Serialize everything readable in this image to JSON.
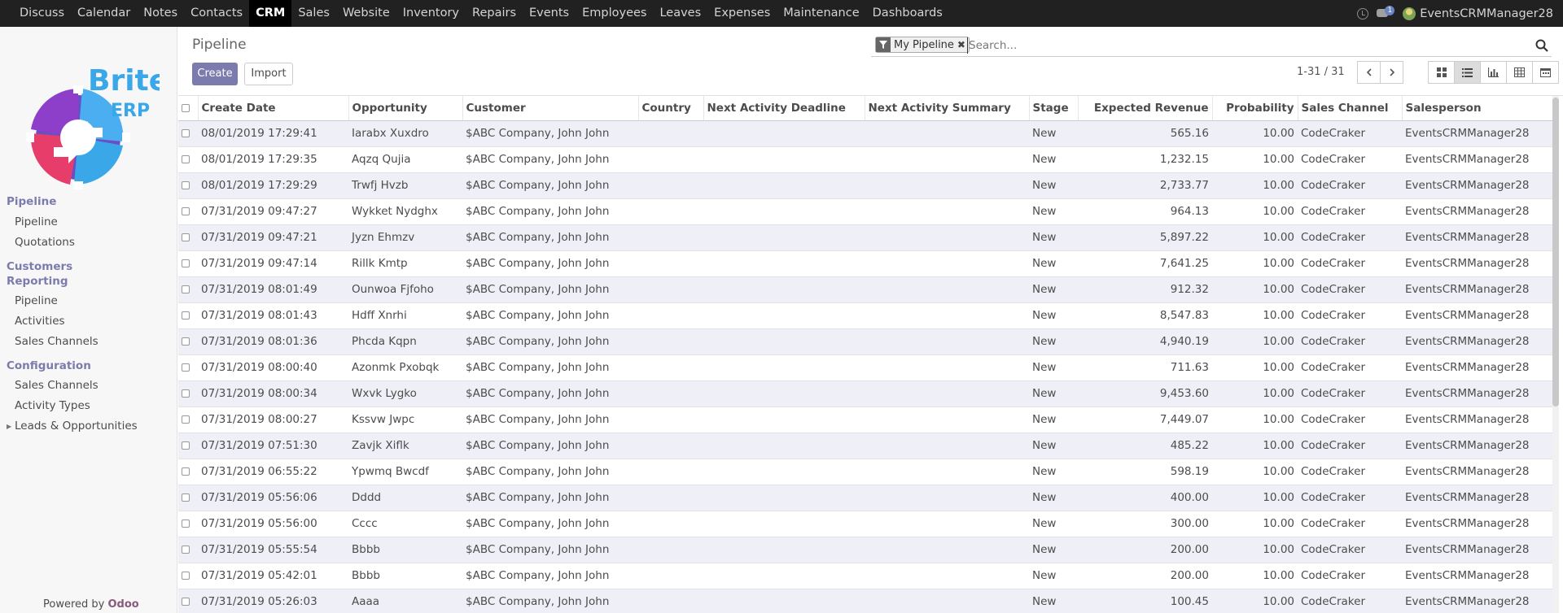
{
  "topbar": {
    "menu": [
      "Discuss",
      "Calendar",
      "Notes",
      "Contacts",
      "CRM",
      "Sales",
      "Website",
      "Inventory",
      "Repairs",
      "Events",
      "Employees",
      "Leaves",
      "Expenses",
      "Maintenance",
      "Dashboards"
    ],
    "active": "CRM",
    "chat_count": "1",
    "user": "EventsCRMManager28"
  },
  "logo": {
    "line1": "Brite",
    "line2": "ERP"
  },
  "sidebar": {
    "section_pipeline": "Pipeline",
    "item_pipeline": "Pipeline",
    "item_quotations": "Quotations",
    "section_customers": "Customers",
    "section_reporting": "Reporting",
    "rep_pipeline": "Pipeline",
    "rep_activities": "Activities",
    "rep_sales_channels": "Sales Channels",
    "section_configuration": "Configuration",
    "conf_sales_channels": "Sales Channels",
    "conf_activity_types": "Activity Types",
    "conf_leads": "Leads & Opportunities",
    "powered_prefix": "Powered by",
    "powered_brand": "Odoo"
  },
  "control": {
    "breadcrumb": "Pipeline",
    "create_label": "Create",
    "import_label": "Import",
    "facet_label": "My Pipeline",
    "search_placeholder": "Search...",
    "pager": "1-31 / 31"
  },
  "table": {
    "headers": [
      "Create Date",
      "Opportunity",
      "Customer",
      "Country",
      "Next Activity Deadline",
      "Next Activity Summary",
      "Stage",
      "Expected Revenue",
      "Probability",
      "Sales Channel",
      "Salesperson"
    ],
    "rows": [
      [
        "08/01/2019 17:29:41",
        "Iarabx Xuxdro",
        "$ABC Company, John John",
        "",
        "",
        "",
        "New",
        "565.16",
        "10.00",
        "CodeCraker",
        "EventsCRMManager28"
      ],
      [
        "08/01/2019 17:29:35",
        "Aqzq Qujia",
        "$ABC Company, John John",
        "",
        "",
        "",
        "New",
        "1,232.15",
        "10.00",
        "CodeCraker",
        "EventsCRMManager28"
      ],
      [
        "08/01/2019 17:29:29",
        "Trwfj Hvzb",
        "$ABC Company, John John",
        "",
        "",
        "",
        "New",
        "2,733.77",
        "10.00",
        "CodeCraker",
        "EventsCRMManager28"
      ],
      [
        "07/31/2019 09:47:27",
        "Wykket Nydghx",
        "$ABC Company, John John",
        "",
        "",
        "",
        "New",
        "964.13",
        "10.00",
        "CodeCraker",
        "EventsCRMManager28"
      ],
      [
        "07/31/2019 09:47:21",
        "Jyzn Ehmzv",
        "$ABC Company, John John",
        "",
        "",
        "",
        "New",
        "5,897.22",
        "10.00",
        "CodeCraker",
        "EventsCRMManager28"
      ],
      [
        "07/31/2019 09:47:14",
        "Rillk Kmtp",
        "$ABC Company, John John",
        "",
        "",
        "",
        "New",
        "7,641.25",
        "10.00",
        "CodeCraker",
        "EventsCRMManager28"
      ],
      [
        "07/31/2019 08:01:49",
        "Ounwoa Fjfoho",
        "$ABC Company, John John",
        "",
        "",
        "",
        "New",
        "912.32",
        "10.00",
        "CodeCraker",
        "EventsCRMManager28"
      ],
      [
        "07/31/2019 08:01:43",
        "Hdff Xnrhi",
        "$ABC Company, John John",
        "",
        "",
        "",
        "New",
        "8,547.83",
        "10.00",
        "CodeCraker",
        "EventsCRMManager28"
      ],
      [
        "07/31/2019 08:01:36",
        "Phcda Kqpn",
        "$ABC Company, John John",
        "",
        "",
        "",
        "New",
        "4,940.19",
        "10.00",
        "CodeCraker",
        "EventsCRMManager28"
      ],
      [
        "07/31/2019 08:00:40",
        "Azonmk Pxobqk",
        "$ABC Company, John John",
        "",
        "",
        "",
        "New",
        "711.63",
        "10.00",
        "CodeCraker",
        "EventsCRMManager28"
      ],
      [
        "07/31/2019 08:00:34",
        "Wxvk Lygko",
        "$ABC Company, John John",
        "",
        "",
        "",
        "New",
        "9,453.60",
        "10.00",
        "CodeCraker",
        "EventsCRMManager28"
      ],
      [
        "07/31/2019 08:00:27",
        "Kssvw Jwpc",
        "$ABC Company, John John",
        "",
        "",
        "",
        "New",
        "7,449.07",
        "10.00",
        "CodeCraker",
        "EventsCRMManager28"
      ],
      [
        "07/31/2019 07:51:30",
        "Zavjk Xiflk",
        "$ABC Company, John John",
        "",
        "",
        "",
        "New",
        "485.22",
        "10.00",
        "CodeCraker",
        "EventsCRMManager28"
      ],
      [
        "07/31/2019 06:55:22",
        "Ypwmq Bwcdf",
        "$ABC Company, John John",
        "",
        "",
        "",
        "New",
        "598.19",
        "10.00",
        "CodeCraker",
        "EventsCRMManager28"
      ],
      [
        "07/31/2019 05:56:06",
        "Dddd",
        "$ABC Company, John John",
        "",
        "",
        "",
        "New",
        "400.00",
        "10.00",
        "CodeCraker",
        "EventsCRMManager28"
      ],
      [
        "07/31/2019 05:56:00",
        "Cccc",
        "$ABC Company, John John",
        "",
        "",
        "",
        "New",
        "300.00",
        "10.00",
        "CodeCraker",
        "EventsCRMManager28"
      ],
      [
        "07/31/2019 05:55:54",
        "Bbbb",
        "$ABC Company, John John",
        "",
        "",
        "",
        "New",
        "200.00",
        "10.00",
        "CodeCraker",
        "EventsCRMManager28"
      ],
      [
        "07/31/2019 05:42:01",
        "Bbbb",
        "$ABC Company, John John",
        "",
        "",
        "",
        "New",
        "200.00",
        "10.00",
        "CodeCraker",
        "EventsCRMManager28"
      ],
      [
        "07/31/2019 05:26:03",
        "Aaaa",
        "$ABC Company, John John",
        "",
        "",
        "",
        "New",
        "100.45",
        "10.00",
        "CodeCraker",
        "EventsCRMManager28"
      ]
    ]
  },
  "colors": {
    "brand": "#7c7bad",
    "navbar": "#212121",
    "row_alt": "#eff0f7",
    "odoo": "#875a7b"
  }
}
